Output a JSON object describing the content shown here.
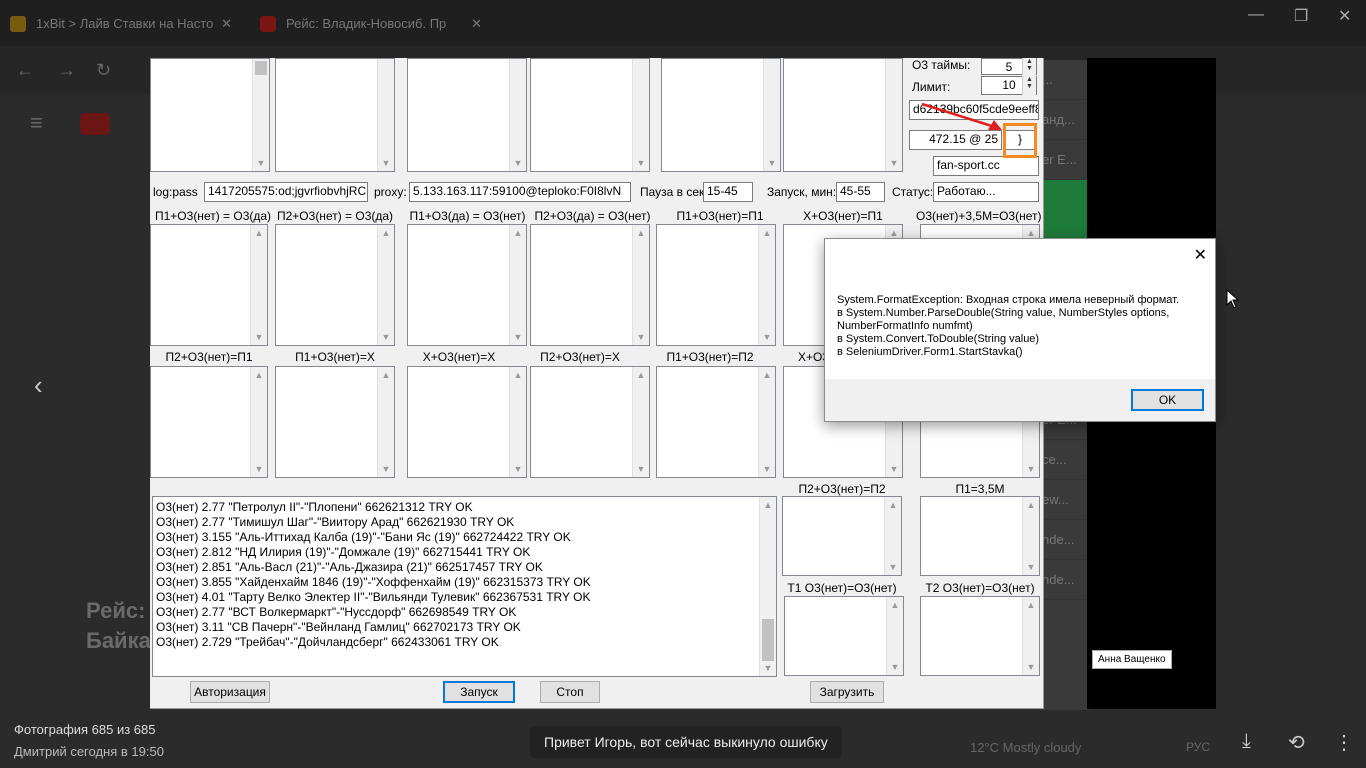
{
  "browser": {
    "tabs": [
      {
        "title": "1xBit > Лайв Ставки на Насто"
      },
      {
        "title": "Рейс: Владик-Новосиб. Пр"
      }
    ],
    "page_title": "Рейс:\nБайка",
    "youtube_logo": "YouTube"
  },
  "form": {
    "o3_timeouts_label": "О3 таймы:",
    "o3_timeouts_value": "5",
    "limit_label": "Лимит:",
    "limit_value": "10",
    "hash_value": "d62139bc60f5cde9eeff8c",
    "bet_value": "472.15 @  25",
    "bet_suffix": "}",
    "site_value": "fan-sport.cc",
    "logpass_label": "log:pass",
    "logpass_value": "1417205575:od;jgvrfiobvhjRC",
    "proxy_label": "proxy:",
    "proxy_value": "5.133.163.117:59100@teploko:F0I8lvN",
    "pause_label": "Пауза в сек.",
    "pause_value": "15-45",
    "start_label": "Запуск, мин:",
    "start_value": "45-55",
    "status_label": "Статус:",
    "status_value": "Работаю...",
    "row1_labels": [
      "П1+О3(нет) = О3(да)",
      "П2+О3(нет) = О3(да)",
      "П1+О3(да) = О3(нет)",
      "П2+О3(да) = О3(нет)",
      "П1+О3(нет)=П1",
      "Х+О3(нет)=П1",
      "О3(нет)+3,5М=О3(нет)"
    ],
    "row2_labels": [
      "П2+О3(нет)=П1",
      "П1+О3(нет)=Х",
      "Х+О3(нет)=Х",
      "П2+О3(нет)=Х",
      "П1+О3(нет)=П2",
      "Х+О3"
    ],
    "row3_labels": [
      "П2+О3(нет)=П2",
      "П1=3,5М"
    ],
    "row4_labels": [
      "Т1  О3(нет)=О3(нет)",
      "Т2  О3(нет)=О3(нет)"
    ],
    "log_lines": [
      "О3(нет) 2.77 \"Петролул II\"-\"Плопени\" 662621312 TRY OK",
      "О3(нет) 2.77 \"Тимишул Шаг\"-\"Виитору Арад\" 662621930 TRY OK",
      "О3(нет) 3.155 \"Аль-Иттихад Калба (19)\"-\"Бани Яс (19)\" 662724422 TRY OK",
      "О3(нет) 2.812 \"НД Илирия (19)\"-\"Домжале (19)\" 662715441 TRY OK",
      "О3(нет) 2.851 \"Аль-Васл (21)\"-\"Аль-Джазира (21)\" 662517457 TRY OK",
      "О3(нет) 3.855 \"Хайденхайм 1846 (19)\"-\"Хоффенхайм (19)\" 662315373 TRY OK",
      "О3(нет) 4.01 \"Тарту Велко Электер II\"-\"Вильянди Тулевик\" 662367531 TRY OK",
      "О3(нет) 2.77 \"ВСТ Волкермаркт\"-\"Нуссдорф\" 662698549 TRY OK",
      "О3(нет) 3.11 \"СВ Пачерн\"-\"Вейнланд Гамлиц\" 662702173 TRY OK",
      "О3(нет) 2.729 \"Трейбач\"-\"Дойчландсберг\" 662433061 TRY OK"
    ],
    "auth_button": "Авторизация",
    "start_button": "Запуск",
    "stop_button": "Стоп",
    "load_button": "Загрузить"
  },
  "dialog": {
    "message": "System.FormatException: Входная строка имела неверный формат.\n   в System.Number.ParseDouble(String value, NumberStyles options, NumberFormatInfo numfmt)\n   в System.Convert.ToDouble(String value)\n   в SeleniumDriver.Form1.StartStavka()",
    "ok_button": "OK"
  },
  "viewer": {
    "photo_counter": "Фотография 685 из 685",
    "author_time": "Дмитрий  сегодня в 19:50",
    "message": "Привет Игорь, вот сейчас выкинуло ошибку",
    "name_tag": "Анна Ващенко"
  },
  "taskbar": {
    "weather": "12°C  Mostly cloudy",
    "lang": "РУС"
  },
  "colors": {
    "highlight_box": "#f28b22",
    "arrow": "#e02020",
    "default_button_border": "#0078d7"
  }
}
